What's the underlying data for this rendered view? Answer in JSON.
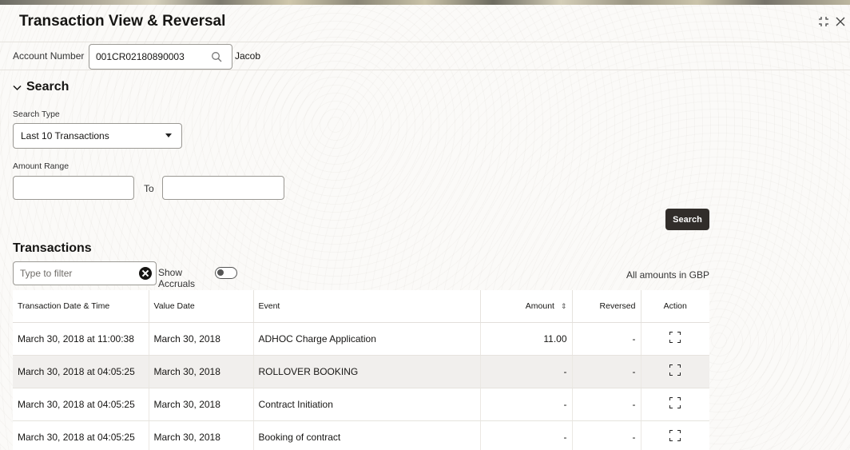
{
  "window": {
    "title": "Transaction View & Reversal"
  },
  "account": {
    "label": "Account Number",
    "value": "001CR02180890003",
    "name": "Jacob"
  },
  "search": {
    "section_title": "Search",
    "search_type_label": "Search Type",
    "search_type_value": "Last 10 Transactions",
    "amount_range_label": "Amount Range",
    "to_label": "To",
    "amount_from": "",
    "amount_to": "",
    "button_label": "Search"
  },
  "transactions": {
    "section_title": "Transactions",
    "filter_placeholder": "Type to filter",
    "show_accruals_label": "Show Accruals",
    "show_accruals_on": false,
    "currency_note": "All amounts in GBP",
    "columns": [
      "Transaction Date & Time",
      "Value Date",
      "Event",
      "Amount",
      "Reversed",
      "Action"
    ],
    "rows": [
      {
        "datetime": "March 30, 2018 at 11:00:38",
        "value_date": "March 30, 2018",
        "event": "ADHOC Charge Application",
        "amount": "11.00",
        "reversed": "-"
      },
      {
        "datetime": "March 30, 2018 at 04:05:25",
        "value_date": "March 30, 2018",
        "event": "ROLLOVER BOOKING",
        "amount": "-",
        "reversed": "-"
      },
      {
        "datetime": "March 30, 2018 at 04:05:25",
        "value_date": "March 30, 2018",
        "event": "Contract Initiation",
        "amount": "-",
        "reversed": "-"
      },
      {
        "datetime": "March 30, 2018 at 04:05:25",
        "value_date": "March 30, 2018",
        "event": "Booking of contract",
        "amount": "-",
        "reversed": "-"
      }
    ]
  },
  "icons": {
    "search": "search-icon",
    "collapse": "collapse-icon",
    "close": "close-icon",
    "chevron": "chevron-down-icon",
    "clear": "clear-icon",
    "sort": "sort-icon",
    "action": "expand-icon"
  }
}
